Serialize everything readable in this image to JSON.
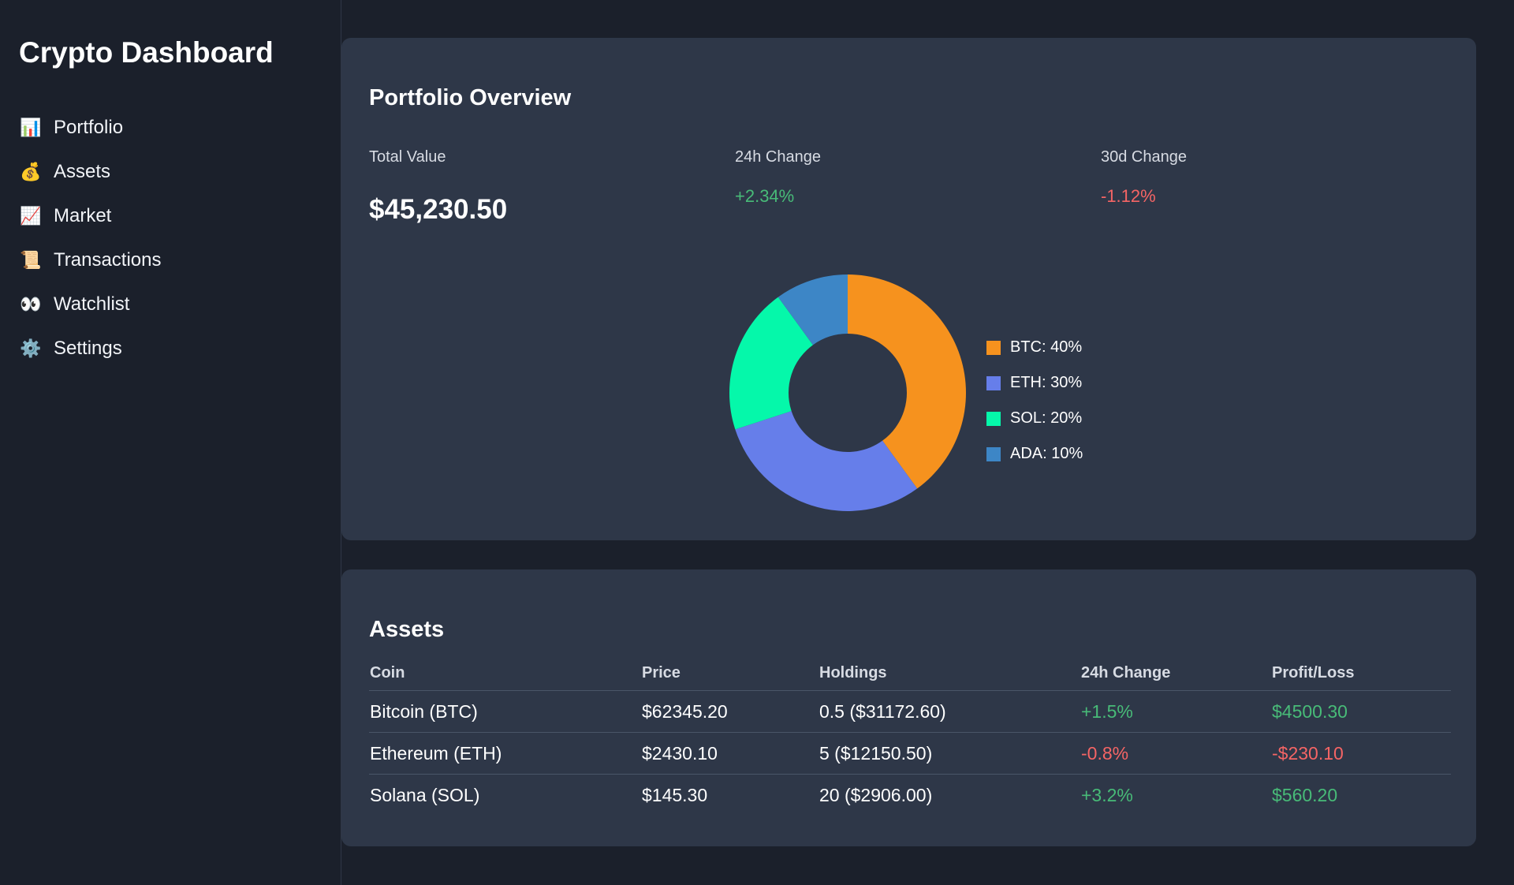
{
  "sidebar": {
    "title": "Crypto Dashboard",
    "items": [
      {
        "label": "Portfolio",
        "icon": "📊",
        "icon_name": "bar-chart-icon"
      },
      {
        "label": "Assets",
        "icon": "💰",
        "icon_name": "money-bag-icon"
      },
      {
        "label": "Market",
        "icon": "📈",
        "icon_name": "trend-up-icon"
      },
      {
        "label": "Transactions",
        "icon": "📜",
        "icon_name": "scroll-icon"
      },
      {
        "label": "Watchlist",
        "icon": "👀",
        "icon_name": "eyes-icon"
      },
      {
        "label": "Settings",
        "icon": "⚙️",
        "icon_name": "gear-icon"
      }
    ]
  },
  "overview": {
    "title": "Portfolio Overview",
    "total_value_label": "Total Value",
    "total_value": "$45,230.50",
    "change_24h_label": "24h Change",
    "change_24h": "+2.34%",
    "change_30d_label": "30d Change",
    "change_30d": "-1.12%"
  },
  "chart_data": {
    "type": "pie",
    "categories": [
      "BTC",
      "ETH",
      "SOL",
      "ADA"
    ],
    "values": [
      40,
      30,
      20,
      10
    ],
    "legend": [
      "BTC: 40%",
      "ETH: 30%",
      "SOL: 20%",
      "ADA: 10%"
    ],
    "colors": [
      "#f6921e",
      "#667eea",
      "#05f8aa",
      "#3d86c6"
    ],
    "donut": true,
    "legend_position": "right"
  },
  "assets": {
    "title": "Assets",
    "columns": [
      "Coin",
      "Price",
      "Holdings",
      "24h Change",
      "Profit/Loss"
    ],
    "rows": [
      {
        "coin": "Bitcoin (BTC)",
        "price": "$62345.20",
        "holdings": "0.5 ($31172.60)",
        "change": "+1.5%",
        "pl": "$4500.30",
        "positive": true
      },
      {
        "coin": "Ethereum (ETH)",
        "price": "$2430.10",
        "holdings": "5 ($12150.50)",
        "change": "-0.8%",
        "pl": "-$230.10",
        "positive": false
      },
      {
        "coin": "Solana (SOL)",
        "price": "$145.30",
        "holdings": "20 ($2906.00)",
        "change": "+3.2%",
        "pl": "$560.20",
        "positive": true
      }
    ]
  },
  "colors": {
    "positive": "#48bb78",
    "negative": "#f56565",
    "card": "#2e3748",
    "background": "#1b202b"
  }
}
